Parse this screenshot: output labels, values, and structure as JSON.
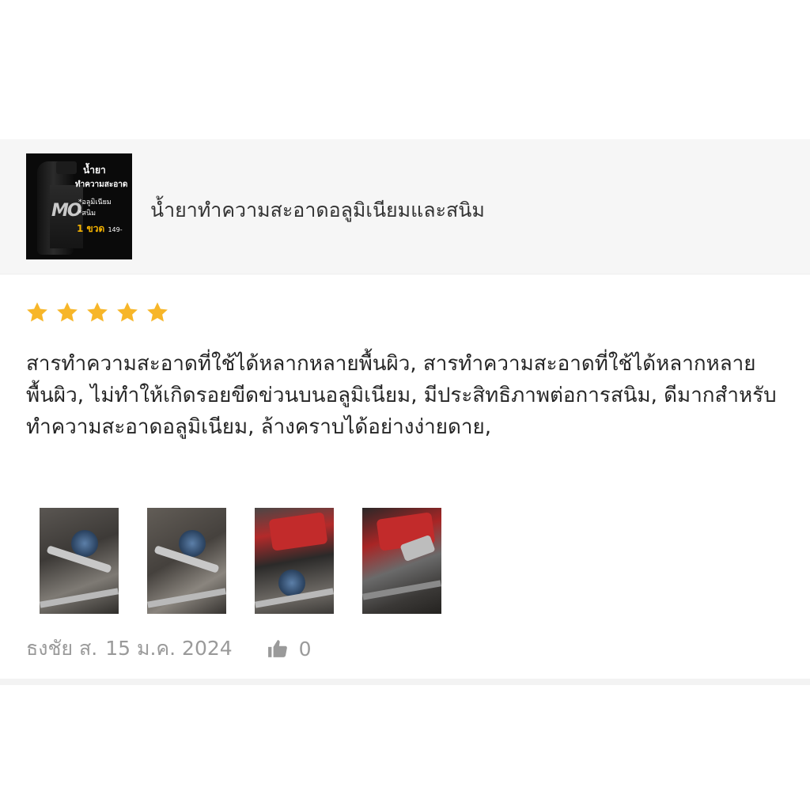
{
  "product": {
    "name": "น้ำยาทำความสะอาดอลูมิเนียมและสนิม",
    "thumbnail": {
      "heading": "น้ำยา",
      "subheading": "ทำความสะอาด",
      "bullet1": "*อลูมิเนียม",
      "bullet2": "*สนิม",
      "price": "1 ขวด",
      "price_value": "149-",
      "logo": "MO"
    }
  },
  "review": {
    "rating": 5,
    "max_rating": 5,
    "star_color": "#f7b629",
    "text": "สารทำความสะอาดที่ใช้ได้หลากหลายพื้นผิว, สารทำความสะอาดที่ใช้ได้หลากหลายพื้นผิว, ไม่ทำให้เกิดรอยขีดข่วนบนอลูมิเนียม, มีประสิทธิภาพต่อการสนิม, ดีมากสำหรับทำความสะอาดอลูมิเนียม, ล้างคราบได้อย่างง่ายดาย,",
    "author": "ธงชัย ส.",
    "date": "15 ม.ค. 2024",
    "like_count": "0",
    "like_icon": "thumbs-up-icon",
    "photos": [
      "photo-1",
      "photo-2",
      "photo-3",
      "photo-4"
    ]
  }
}
